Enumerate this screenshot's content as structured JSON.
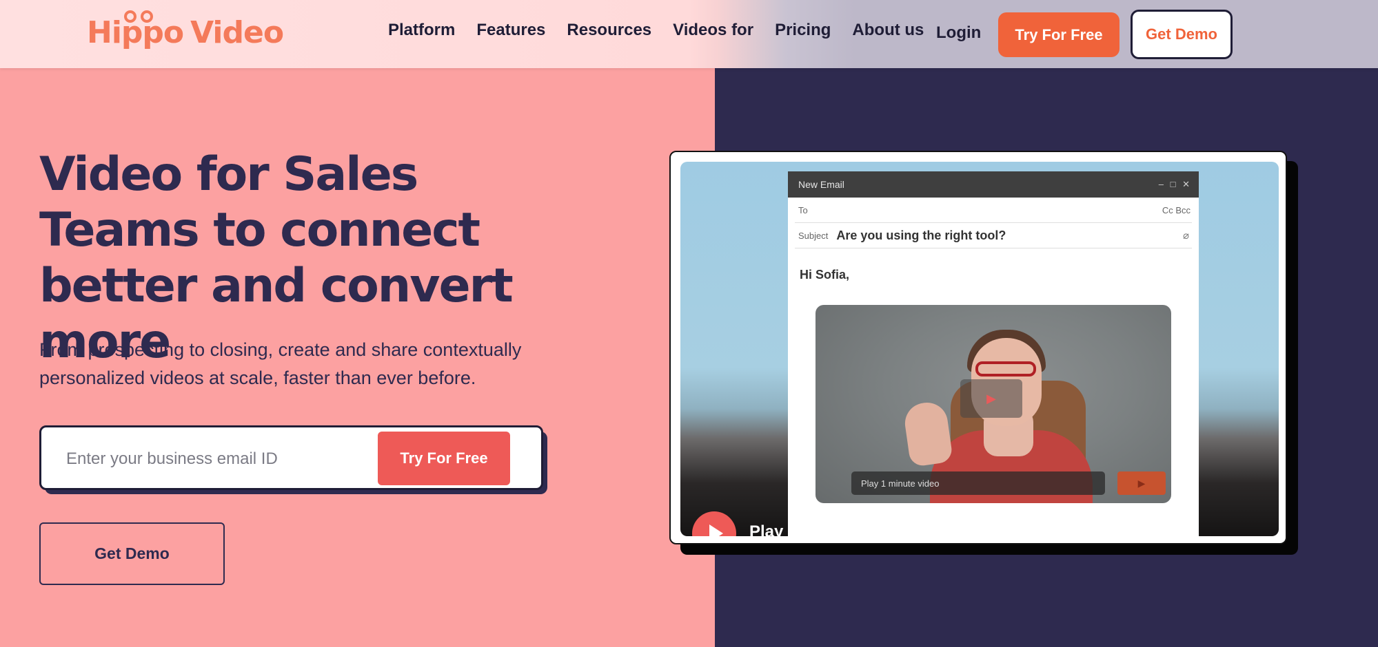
{
  "brand": {
    "logo_text_a": "Hippo",
    "logo_text_b": "Video",
    "accent": "#f0633a"
  },
  "nav": {
    "links": [
      "Platform",
      "Features",
      "Resources",
      "Videos for",
      "Pricing",
      "About us"
    ],
    "login": "Login",
    "try_free": "Try For Free",
    "get_demo": "Get Demo"
  },
  "hero": {
    "headline": "Video for Sales Teams to connect better and convert more",
    "subhead": "From prospecting to closing, create and share contextually personalized videos at scale, faster than ever before.",
    "email_placeholder": "Enter your business email ID",
    "try_free": "Try For Free",
    "get_demo": "Get Demo"
  },
  "preview": {
    "window_title": "New Email",
    "window_controls": "– □ ✕",
    "to_label": "To",
    "cc_bcc": "Cc  Bcc",
    "subject_label": "Subject",
    "subject_value": "Are you using the right tool?",
    "greeting": "Hi Sofia,",
    "play_bar_text": "Play 1 minute video",
    "play_label": "Play video"
  }
}
